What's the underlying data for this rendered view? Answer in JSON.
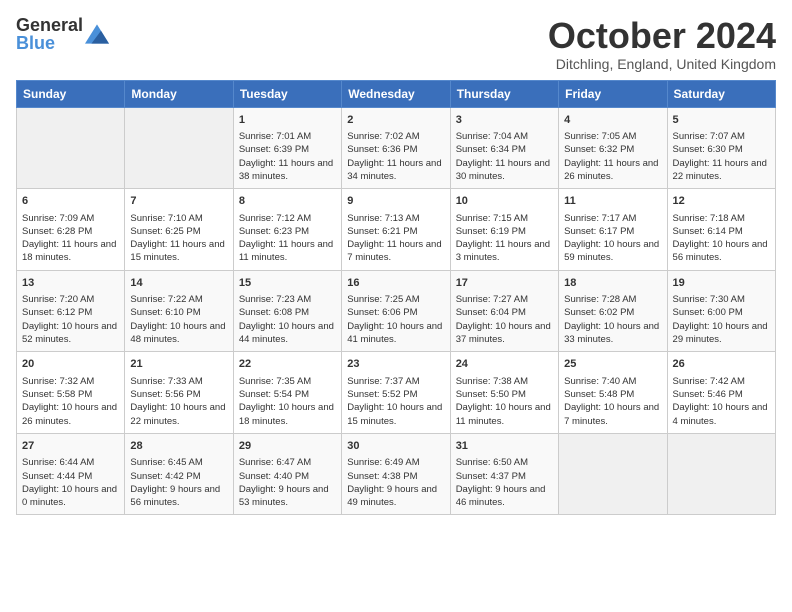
{
  "header": {
    "logo_general": "General",
    "logo_blue": "Blue",
    "month_title": "October 2024",
    "subtitle": "Ditchling, England, United Kingdom"
  },
  "days_of_week": [
    "Sunday",
    "Monday",
    "Tuesday",
    "Wednesday",
    "Thursday",
    "Friday",
    "Saturday"
  ],
  "weeks": [
    [
      {
        "day": "",
        "content": ""
      },
      {
        "day": "",
        "content": ""
      },
      {
        "day": "1",
        "content": "Sunrise: 7:01 AM\nSunset: 6:39 PM\nDaylight: 11 hours and 38 minutes."
      },
      {
        "day": "2",
        "content": "Sunrise: 7:02 AM\nSunset: 6:36 PM\nDaylight: 11 hours and 34 minutes."
      },
      {
        "day": "3",
        "content": "Sunrise: 7:04 AM\nSunset: 6:34 PM\nDaylight: 11 hours and 30 minutes."
      },
      {
        "day": "4",
        "content": "Sunrise: 7:05 AM\nSunset: 6:32 PM\nDaylight: 11 hours and 26 minutes."
      },
      {
        "day": "5",
        "content": "Sunrise: 7:07 AM\nSunset: 6:30 PM\nDaylight: 11 hours and 22 minutes."
      }
    ],
    [
      {
        "day": "6",
        "content": "Sunrise: 7:09 AM\nSunset: 6:28 PM\nDaylight: 11 hours and 18 minutes."
      },
      {
        "day": "7",
        "content": "Sunrise: 7:10 AM\nSunset: 6:25 PM\nDaylight: 11 hours and 15 minutes."
      },
      {
        "day": "8",
        "content": "Sunrise: 7:12 AM\nSunset: 6:23 PM\nDaylight: 11 hours and 11 minutes."
      },
      {
        "day": "9",
        "content": "Sunrise: 7:13 AM\nSunset: 6:21 PM\nDaylight: 11 hours and 7 minutes."
      },
      {
        "day": "10",
        "content": "Sunrise: 7:15 AM\nSunset: 6:19 PM\nDaylight: 11 hours and 3 minutes."
      },
      {
        "day": "11",
        "content": "Sunrise: 7:17 AM\nSunset: 6:17 PM\nDaylight: 10 hours and 59 minutes."
      },
      {
        "day": "12",
        "content": "Sunrise: 7:18 AM\nSunset: 6:14 PM\nDaylight: 10 hours and 56 minutes."
      }
    ],
    [
      {
        "day": "13",
        "content": "Sunrise: 7:20 AM\nSunset: 6:12 PM\nDaylight: 10 hours and 52 minutes."
      },
      {
        "day": "14",
        "content": "Sunrise: 7:22 AM\nSunset: 6:10 PM\nDaylight: 10 hours and 48 minutes."
      },
      {
        "day": "15",
        "content": "Sunrise: 7:23 AM\nSunset: 6:08 PM\nDaylight: 10 hours and 44 minutes."
      },
      {
        "day": "16",
        "content": "Sunrise: 7:25 AM\nSunset: 6:06 PM\nDaylight: 10 hours and 41 minutes."
      },
      {
        "day": "17",
        "content": "Sunrise: 7:27 AM\nSunset: 6:04 PM\nDaylight: 10 hours and 37 minutes."
      },
      {
        "day": "18",
        "content": "Sunrise: 7:28 AM\nSunset: 6:02 PM\nDaylight: 10 hours and 33 minutes."
      },
      {
        "day": "19",
        "content": "Sunrise: 7:30 AM\nSunset: 6:00 PM\nDaylight: 10 hours and 29 minutes."
      }
    ],
    [
      {
        "day": "20",
        "content": "Sunrise: 7:32 AM\nSunset: 5:58 PM\nDaylight: 10 hours and 26 minutes."
      },
      {
        "day": "21",
        "content": "Sunrise: 7:33 AM\nSunset: 5:56 PM\nDaylight: 10 hours and 22 minutes."
      },
      {
        "day": "22",
        "content": "Sunrise: 7:35 AM\nSunset: 5:54 PM\nDaylight: 10 hours and 18 minutes."
      },
      {
        "day": "23",
        "content": "Sunrise: 7:37 AM\nSunset: 5:52 PM\nDaylight: 10 hours and 15 minutes."
      },
      {
        "day": "24",
        "content": "Sunrise: 7:38 AM\nSunset: 5:50 PM\nDaylight: 10 hours and 11 minutes."
      },
      {
        "day": "25",
        "content": "Sunrise: 7:40 AM\nSunset: 5:48 PM\nDaylight: 10 hours and 7 minutes."
      },
      {
        "day": "26",
        "content": "Sunrise: 7:42 AM\nSunset: 5:46 PM\nDaylight: 10 hours and 4 minutes."
      }
    ],
    [
      {
        "day": "27",
        "content": "Sunrise: 6:44 AM\nSunset: 4:44 PM\nDaylight: 10 hours and 0 minutes."
      },
      {
        "day": "28",
        "content": "Sunrise: 6:45 AM\nSunset: 4:42 PM\nDaylight: 9 hours and 56 minutes."
      },
      {
        "day": "29",
        "content": "Sunrise: 6:47 AM\nSunset: 4:40 PM\nDaylight: 9 hours and 53 minutes."
      },
      {
        "day": "30",
        "content": "Sunrise: 6:49 AM\nSunset: 4:38 PM\nDaylight: 9 hours and 49 minutes."
      },
      {
        "day": "31",
        "content": "Sunrise: 6:50 AM\nSunset: 4:37 PM\nDaylight: 9 hours and 46 minutes."
      },
      {
        "day": "",
        "content": ""
      },
      {
        "day": "",
        "content": ""
      }
    ]
  ]
}
